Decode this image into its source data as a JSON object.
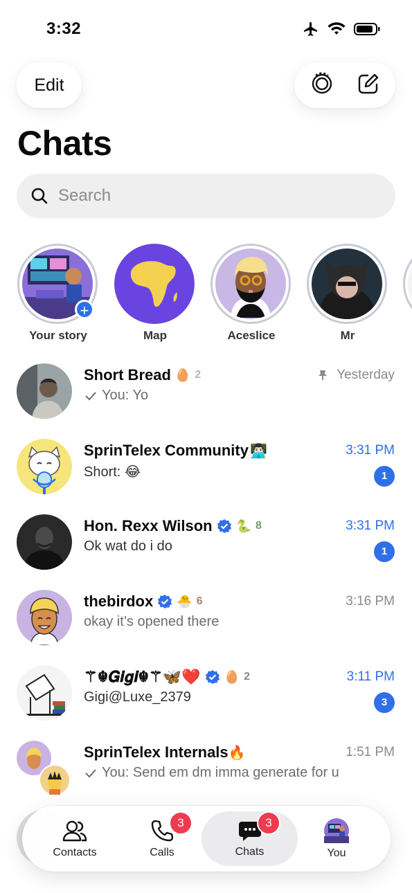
{
  "status_bar": {
    "time": "3:32"
  },
  "header": {
    "edit_label": "Edit",
    "title": "Chats"
  },
  "search": {
    "placeholder": "Search"
  },
  "stories": [
    {
      "label": "Your story"
    },
    {
      "label": "Map"
    },
    {
      "label": "Aceslice"
    },
    {
      "label": "Mr"
    }
  ],
  "chats": [
    {
      "name": "Short Bread",
      "status_emoji": "🥚",
      "status_count": "2",
      "time": "Yesterday",
      "message": "You: Yo"
    },
    {
      "name": "SprinTelex Community",
      "name_emoji": "👨🏻‍💻",
      "time": "3:31 PM",
      "message": "Short: 😂",
      "unread": "1"
    },
    {
      "name": "Hon. Rexx Wilson",
      "status_emoji": "🐍",
      "status_count": "8",
      "time": "3:31 PM",
      "message": "Ok wat do i do",
      "unread": "1"
    },
    {
      "name": "thebirdox",
      "status_emoji": "🐣",
      "status_count": "6",
      "time": "3:16 PM",
      "message": "okay it’s opened there"
    },
    {
      "name": "⚚☬𝑮𝒊𝒈𝒊☬⚚🦋❤️",
      "status_emoji": "🥚",
      "status_count": "2",
      "time": "3:11 PM",
      "message": "Gigi@Luxe_2379",
      "unread": "3"
    },
    {
      "name": "SprinTelex Internals",
      "name_emoji": "🔥",
      "time": "1:51 PM",
      "message": "You: Send em dm imma generate for u"
    }
  ],
  "tabbar": {
    "contacts": "Contacts",
    "calls": "Calls",
    "calls_badge": "3",
    "chats": "Chats",
    "chats_badge": "3",
    "you": "You"
  },
  "colors": {
    "accent": "#2f6fe8",
    "badge": "#ef3b4f"
  }
}
